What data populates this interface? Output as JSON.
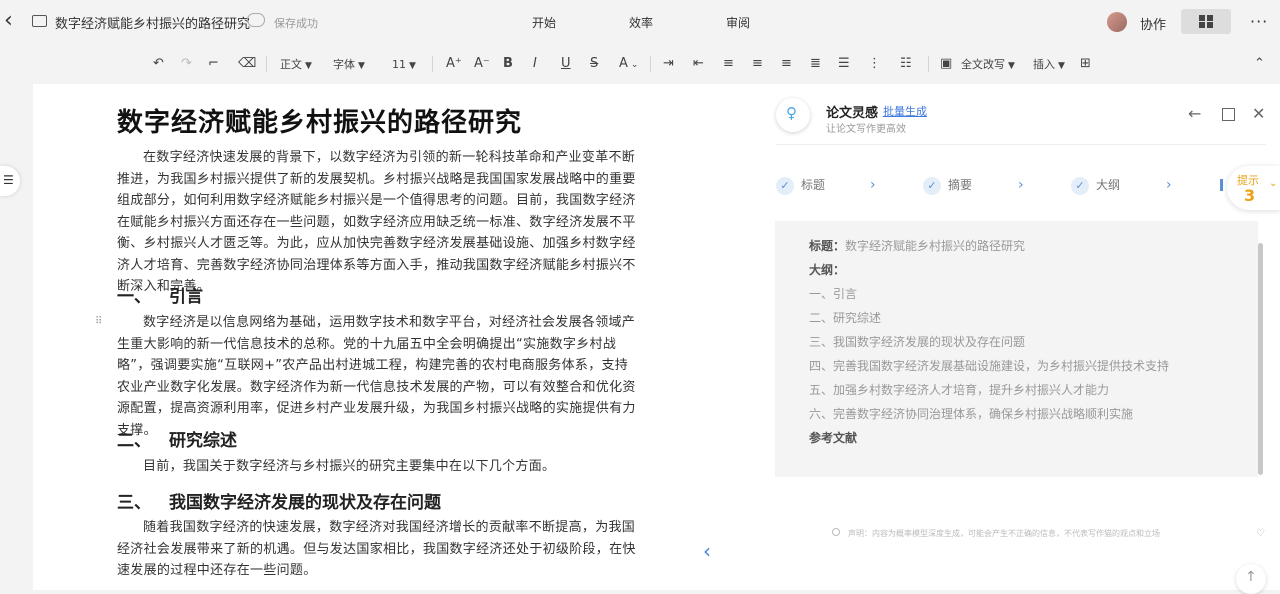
{
  "header": {
    "doc_title": "数字经济赋能乡村振兴的路径研究",
    "save_status": "保存成功",
    "tabs": [
      "开始",
      "效率",
      "审阅"
    ],
    "collab": "协作",
    "more": "···"
  },
  "toolbar": {
    "style": "正文",
    "font": "字体",
    "size": "11",
    "rewrite": "全文改写",
    "insert": "插入"
  },
  "document": {
    "title": "数字经济赋能乡村振兴的路径研究",
    "intro": "在数字经济快速发展的背景下，以数字经济为引领的新一轮科技革命和产业变革不断推进，为我国乡村振兴提供了新的发展契机。乡村振兴战略是我国国家发展战略中的重要组成部分，如何利用数字经济赋能乡村振兴是一个值得思考的问题。目前，我国数字经济在赋能乡村振兴方面还存在一些问题，如数字经济应用缺乏统一标准、数字经济发展不平衡、乡村振兴人才匮乏等。为此，应从加快完善数字经济发展基础设施、加强乡村数字经济人才培育、完善数字经济协同治理体系等方面入手，推动我国数字经济赋能乡村振兴不断深入和完善。",
    "s1_num": "一、",
    "s1_title": "引言",
    "s1_para": "数字经济是以信息网络为基础，运用数字技术和数字平台，对经济社会发展各领域产生重大影响的新一代信息技术的总称。党的十九届五中全会明确提出“实施数字乡村战略”，强调要实施“互联网+”农产品出村进城工程，构建完善的农村电商服务体系，支持农业产业数字化发展。数字经济作为新一代信息技术发展的产物，可以有效整合和优化资源配置，提高资源利用率，促进乡村产业发展升级，为我国乡村振兴战略的实施提供有力支撑。",
    "s2_num": "二、",
    "s2_title": "研究综述",
    "s2_para": "目前，我国关于数字经济与乡村振兴的研究主要集中在以下几个方面。",
    "s3_num": "三、",
    "s3_title": "我国数字经济发展的现状及存在问题",
    "s3_para": "随着我国数字经济的快速发展，数字经济对我国经济增长的贡献率不断提高，为我国经济社会发展带来了新的机遇。但与发达国家相比，我国数字经济还处于初级阶段，在快速发展的过程中还存在一些问题。"
  },
  "panel": {
    "title": "论文灵感",
    "batch": "批量生成",
    "subtitle": "让论文写作更高效",
    "steps": [
      "标题",
      "摘要",
      "大纲"
    ],
    "hint_label": "提示",
    "hint_count": "3",
    "outline": {
      "title_label": "标题：",
      "title_value": "数字经济赋能乡村振兴的路径研究",
      "outline_label": "大纲：",
      "items": [
        "一、引言",
        "二、研究综述",
        "三、我国数字经济发展的现状及存在问题",
        "四、完善我国数字经济发展基础设施建设，为乡村振兴提供技术支持",
        "五、加强乡村数字经济人才培育，提升乡村振兴人才能力",
        "六、完善数字经济协同治理体系，确保乡村振兴战略顺利实施"
      ],
      "references": "参考文献"
    },
    "disclaimer": "声明：内容为概率模型深度生成，可能会产生不正确的信息，不代表写作猫的观点和立场"
  }
}
